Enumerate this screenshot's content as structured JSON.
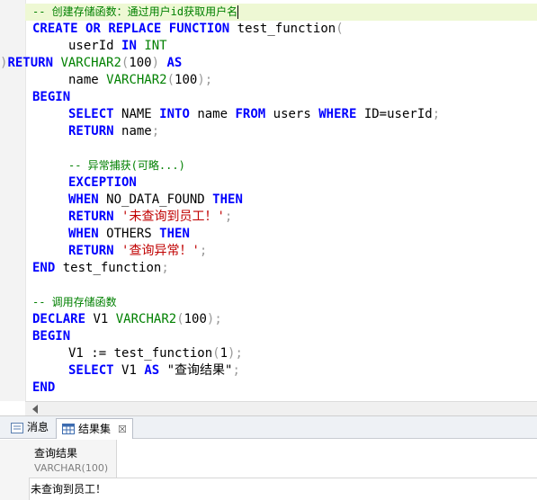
{
  "editor": {
    "line1_comment": "-- 创建存储函数：通过用户id获取用户名",
    "l2": {
      "create": "CREATE",
      "or": "OR",
      "replace": "REPLACE",
      "function": "FUNCTION",
      "name": "test_function",
      "paren": "("
    },
    "l3": {
      "param": "userId",
      "in": "IN",
      "type": "INT"
    },
    "l4": {
      "paren": ")",
      "return": "RETURN",
      "type": "VARCHAR2",
      "open": "(",
      "len": "100",
      "close": ")",
      "as": "AS"
    },
    "l5": {
      "var": "name",
      "type": "VARCHAR2",
      "open": "(",
      "len": "100",
      "close": ");"
    },
    "l6": {
      "begin": "BEGIN"
    },
    "l7": {
      "select": "SELECT",
      "col": "NAME",
      "into": "INTO",
      "var": "name",
      "from": "FROM",
      "table": "users",
      "where": "WHERE",
      "cond": "ID=userId",
      "semi": ";"
    },
    "l8": {
      "return": "RETURN",
      "var": "name",
      "semi": ";"
    },
    "l10_comment": "-- 异常捕获(可略...)",
    "l11": {
      "exception": "EXCEPTION"
    },
    "l12": {
      "when": "WHEN",
      "cond": "NO_DATA_FOUND",
      "then": "THEN"
    },
    "l13": {
      "return": "RETURN",
      "str": "'未查询到员工！'",
      "semi": ";"
    },
    "l14": {
      "when": "WHEN",
      "cond": "OTHERS",
      "then": "THEN"
    },
    "l15": {
      "return": "RETURN",
      "str": "'查询异常！'",
      "semi": ";"
    },
    "l16": {
      "end": "END",
      "name": "test_function",
      "semi": ";"
    },
    "l18_comment": "-- 调用存储函数",
    "l19": {
      "declare": "DECLARE",
      "var": "V1",
      "type": "VARCHAR2",
      "open": "(",
      "len": "100",
      "close": ");"
    },
    "l20": {
      "begin": "BEGIN"
    },
    "l21": {
      "var": "V1",
      "assign": ":=",
      "fn": "test_function",
      "open": "(",
      "arg": "1",
      "close": ");"
    },
    "l22": {
      "select": "SELECT",
      "var": "V1",
      "as": "AS",
      "alias": "\"查询结果\"",
      "semi": ";"
    },
    "l23": {
      "end": "END"
    }
  },
  "panel": {
    "tabs": [
      {
        "label": "消息"
      },
      {
        "label": "结果集"
      }
    ],
    "close_glyph": "☒",
    "column": {
      "name": "查询结果",
      "type": "VARCHAR(100)"
    },
    "rows": [
      {
        "value": "未查询到员工！"
      }
    ]
  }
}
